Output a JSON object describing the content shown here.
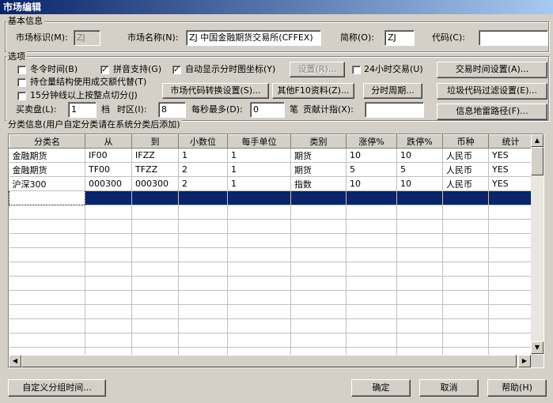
{
  "window": {
    "title": "市场编辑"
  },
  "basic": {
    "legend": "基本信息",
    "market_id_label": "市场标识(M):",
    "market_id_value": "ZJ",
    "market_name_label": "市场名称(N):",
    "market_name_value": "ZJ 中国金融期货交易所(CFFEX)",
    "short_label": "简称(O):",
    "short_value": "ZJ",
    "code_label": "代码(C):",
    "code_value": ""
  },
  "options": {
    "legend": "选项",
    "winter_time": "冬令时间(B)",
    "pinyin": "拼音支持(G)",
    "auto_show": "自动显示分时图坐标(Y)",
    "settings_btn": "设置(R)...",
    "h24": "24小时交易(U)",
    "trade_time_btn": "交易时间设置(A)...",
    "position_struct": "持仓量结构使用成交额代替(T)",
    "code_convert_btn": "市场代码转换设置(S)...",
    "f10_btn": "其他F10资料(Z)...",
    "period_btn": "分时周期...",
    "junk_filter_btn": "垃圾代码过滤设置(E)...",
    "min15": "15分钟线以上按整点切分(J)",
    "quote_label": "买卖盘(L):",
    "quote_value": "1",
    "dang_label": "档",
    "tz_label": "时区(I):",
    "tz_value": "8",
    "per_sec_label": "每秒最多(D):",
    "per_sec_value": "0",
    "bi_label": "笔",
    "contrib_label": "贡献计指(X):",
    "contrib_value": "",
    "info_path_btn": "信息地雷路径(F)..."
  },
  "category": {
    "legend": "分类信息(用户自定分类请在系统分类后添加)",
    "columns": [
      "分类名",
      "从",
      "到",
      "小数位",
      "每手单位",
      "类别",
      "涨停%",
      "跌停%",
      "币种",
      "统计"
    ],
    "rows": [
      [
        "金融期货",
        "IF00",
        "IFZZ",
        "1",
        "1",
        "期货",
        "10",
        "10",
        "人民币",
        "YES"
      ],
      [
        "金融期货",
        "TF00",
        "TFZZ",
        "2",
        "1",
        "期货",
        "5",
        "5",
        "人民币",
        "YES"
      ],
      [
        "沪深300",
        "000300",
        "000300",
        "2",
        "1",
        "指数",
        "10",
        "10",
        "人民币",
        "YES"
      ]
    ]
  },
  "footer": {
    "custom_group_btn": "自定义分组时间...",
    "ok_btn": "确定",
    "cancel_btn": "取消",
    "help_btn": "帮助(H)"
  }
}
